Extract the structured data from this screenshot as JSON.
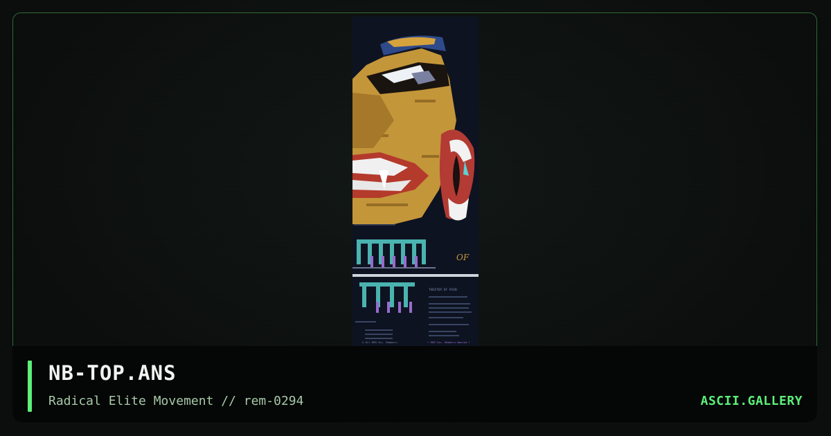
{
  "artwork": {
    "title": "NB-TOP.ANS",
    "group": "Radical Elite Movement // rem-0294",
    "art_header": "THEATER OF PAIN",
    "art_footer_left": "© All REM Inc. Members.",
    "art_footer_right": "• REM Inc. Members Wanted •"
  },
  "branding": {
    "site": "ASCII.GALLERY"
  },
  "colors": {
    "accent": "#5cf07a",
    "frame_border": "#2f6b34",
    "face": "#c99a3c",
    "logo_teal": "#4ab3b0",
    "logo_purple": "#9a6ad0"
  }
}
